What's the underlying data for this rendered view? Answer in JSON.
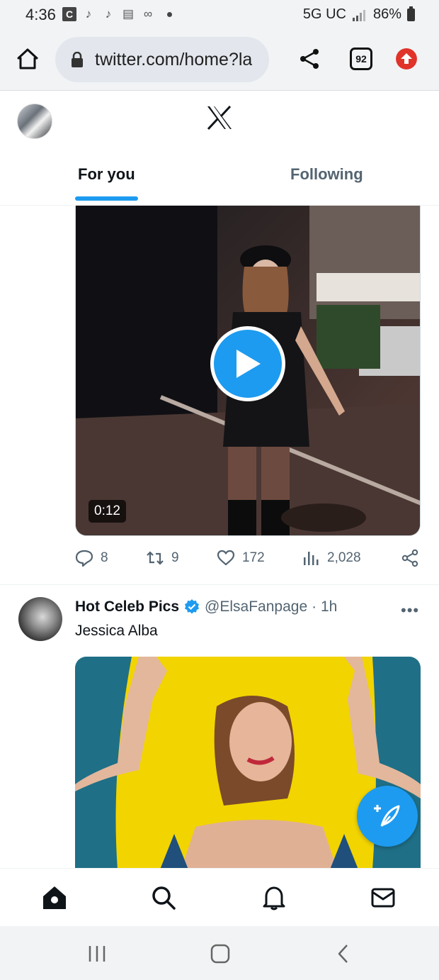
{
  "status_bar": {
    "time": "4:36",
    "notif_c": "C",
    "network": "5G UC",
    "battery": "86%"
  },
  "browser": {
    "url": "twitter.com/home?la",
    "tab_count": "92",
    "accent_color": "#e0332a"
  },
  "header": {
    "logo": "x-logo-icon",
    "tabs": [
      {
        "label": "For you",
        "active": true
      },
      {
        "label": "Following",
        "active": false
      }
    ],
    "accent_color": "#1d9bf0"
  },
  "tweet1": {
    "video_duration": "0:12",
    "replies": "8",
    "retweets": "9",
    "likes": "172",
    "views": "2,028"
  },
  "tweet2": {
    "name": "Hot Celeb Pics",
    "verified": true,
    "handle": "@ElsaFanpage",
    "time": "· 1h",
    "text": "Jessica Alba"
  },
  "bottom_nav": [
    "home-icon",
    "search-icon",
    "bell-icon",
    "mail-icon"
  ],
  "android_nav": [
    "recent-apps-icon",
    "home-icon",
    "back-icon"
  ]
}
